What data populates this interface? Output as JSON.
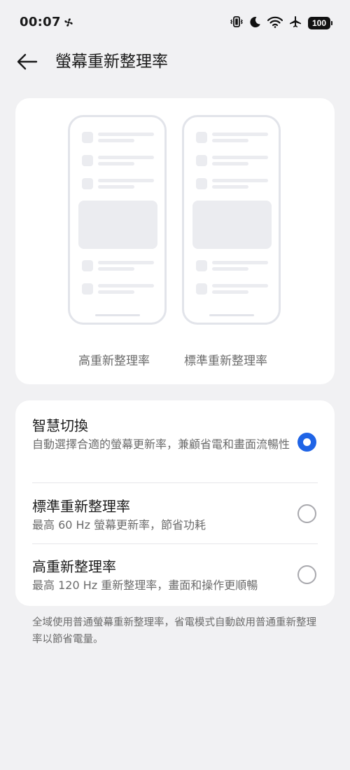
{
  "status_bar": {
    "time": "00:07",
    "battery": "100",
    "icons": [
      "fan-icon",
      "vibrate-icon",
      "moon-icon",
      "wifi-icon",
      "airplane-icon",
      "battery-icon"
    ]
  },
  "header": {
    "back_icon": "arrow-left-icon",
    "title": "螢幕重新整理率"
  },
  "preview": {
    "high_label": "高重新整理率",
    "standard_label": "標準重新整理率"
  },
  "options": [
    {
      "title": "智慧切換",
      "desc": "自動選擇合適的螢幕更新率，兼顧省電和畫面流暢性",
      "selected": true
    },
    {
      "title": "標準重新整理率",
      "desc": "最高 60 Hz 螢幕更新率，節省功耗",
      "selected": false
    },
    {
      "title": "高重新整理率",
      "desc": "最高 120 Hz 重新整理率，畫面和操作更順暢",
      "selected": false
    }
  ],
  "footnote": "全域使用普通螢幕重新整理率，省電模式自動啟用普通重新整理率以節省電量。",
  "colors": {
    "accent": "#1f64e6",
    "background": "#f1f1f3",
    "card": "#ffffff"
  }
}
